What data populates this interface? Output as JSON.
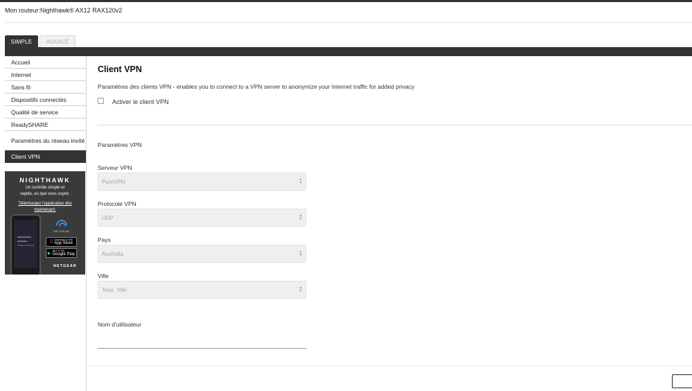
{
  "header": {
    "router_title": "Mon routeur:Nighthawk® AX12 RAX120v2"
  },
  "tabs": [
    {
      "label": "SIMPLE",
      "active": true
    },
    {
      "label": "AVANCÉ",
      "active": false
    }
  ],
  "sidebar": {
    "items": [
      {
        "label": "Accueil"
      },
      {
        "label": "Internet"
      },
      {
        "label": "Sans fil"
      },
      {
        "label": "Dispositifs connectés"
      },
      {
        "label": "Qualité de service"
      },
      {
        "label": "ReadySHARE"
      },
      {
        "label": "Paramètres du réseau invité"
      },
      {
        "label": "Client VPN",
        "active": true
      }
    ]
  },
  "promo": {
    "brand": "NIGHTHAWK",
    "line1": "Un contrôle simple et",
    "line2": "rapide, où que vous soyez.",
    "link1": "Téléchargez l'application dès",
    "link2": "maintenant.",
    "router_label": "NETGEAR",
    "appstore_small": "Download on the",
    "appstore": "App Store",
    "googleplay_small": "GET IT ON",
    "googleplay": "Google Play",
    "logo": "NETGEAR"
  },
  "main": {
    "title": "Client VPN",
    "description": "Paramètres des clients VPN - enables you to connect to a VPN server to anonymize your Internet traffic for added privacy",
    "enable_label": "Activer le client VPN",
    "enable_checked": false,
    "section_title": "Paramètres VPN",
    "fields": {
      "server": {
        "label": "Serveur VPN",
        "value": "PureVPN"
      },
      "protocol": {
        "label": "Protocole VPN",
        "value": "UDP"
      },
      "country": {
        "label": "Pays",
        "value": "Australia"
      },
      "city": {
        "label": "Ville",
        "value": "Tous  Ville"
      },
      "username": {
        "label": "Nom d'utilisateur",
        "value": ""
      }
    }
  },
  "colors": {
    "dark_bar": "#333333",
    "accent_blue": "#3c8de0"
  },
  "icons": [
    "checkbox-icon",
    "select-arrows-icon",
    "wifi-icon",
    "apple-icon",
    "play-icon"
  ]
}
